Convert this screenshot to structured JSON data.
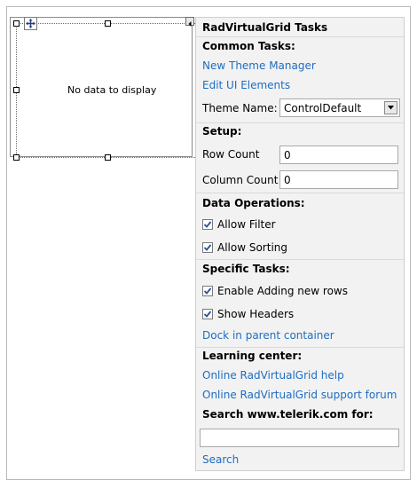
{
  "grid": {
    "empty_text": "No data to display"
  },
  "panel": {
    "title": "RadVirtualGrid Tasks",
    "common": {
      "heading": "Common Tasks:",
      "new_theme_manager": "New Theme Manager",
      "edit_ui_elements": "Edit UI Elements",
      "theme_name_label": "Theme Name:",
      "theme_name_value": "ControlDefault"
    },
    "setup": {
      "heading": "Setup:",
      "row_count_label": "Row Count",
      "row_count_value": "0",
      "column_count_label": "Column Count",
      "column_count_value": "0"
    },
    "data_operations": {
      "heading": "Data Operations:",
      "allow_filter": {
        "label": "Allow Filter",
        "checked": true
      },
      "allow_sorting": {
        "label": "Allow Sorting",
        "checked": true
      }
    },
    "specific": {
      "heading": "Specific Tasks:",
      "enable_adding": {
        "label": "Enable Adding new rows",
        "checked": true
      },
      "show_headers": {
        "label": "Show Headers",
        "checked": true
      },
      "dock_link": "Dock in parent container"
    },
    "learning": {
      "heading": "Learning center:",
      "help_link": "Online RadVirtualGrid help",
      "forum_link": "Online RadVirtualGrid support forum",
      "search_heading": "Search www.telerik.com for:",
      "search_value": "",
      "search_link": "Search"
    }
  },
  "colors": {
    "link": "#1f6dc1",
    "panel_bg": "#f2f2f2"
  }
}
